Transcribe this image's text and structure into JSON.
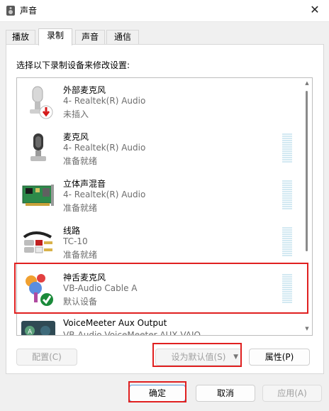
{
  "window": {
    "title": "声音",
    "close_symbol": "✕"
  },
  "tabs": [
    {
      "label": "播放",
      "active": false
    },
    {
      "label": "录制",
      "active": true
    },
    {
      "label": "声音",
      "active": false
    },
    {
      "label": "通信",
      "active": false
    }
  ],
  "panel": {
    "instruction": "选择以下录制设备来修改设置:"
  },
  "devices": [
    {
      "name": "外部麦克风",
      "desc": "4- Realtek(R) Audio",
      "status": "未插入",
      "icon": "external-microphone-icon",
      "badge": "unplugged-arrow-badge-icon"
    },
    {
      "name": "麦克风",
      "desc": "4- Realtek(R) Audio",
      "status": "准备就绪",
      "icon": "microphone-icon"
    },
    {
      "name": "立体声混音",
      "desc": "4- Realtek(R) Audio",
      "status": "准备就绪",
      "icon": "sound-card-icon"
    },
    {
      "name": "线路",
      "desc": "TC-10",
      "status": "准备就绪",
      "icon": "line-in-cable-icon"
    },
    {
      "name": "神舌麦克风",
      "desc": "VB-Audio Cable A",
      "status": "默认设备",
      "icon": "virtual-cable-icon",
      "badge": "default-checkmark-badge-icon"
    },
    {
      "name": "VoiceMeeter Aux Output",
      "desc": "VB-Audio VoiceMeeter AUX VAIO",
      "status": "",
      "icon": "voicemeeter-icon"
    }
  ],
  "buttons": {
    "configure": "配置(C)",
    "set_default": "设为默认值(S)",
    "properties": "属性(P)",
    "ok": "确定",
    "cancel": "取消",
    "apply": "应用(A)"
  },
  "colors": {
    "highlight": "#e02020",
    "default_check": "#1a8a3a",
    "unplugged_badge": "#d51a1a",
    "meter_idle": "#d3e9f2"
  }
}
